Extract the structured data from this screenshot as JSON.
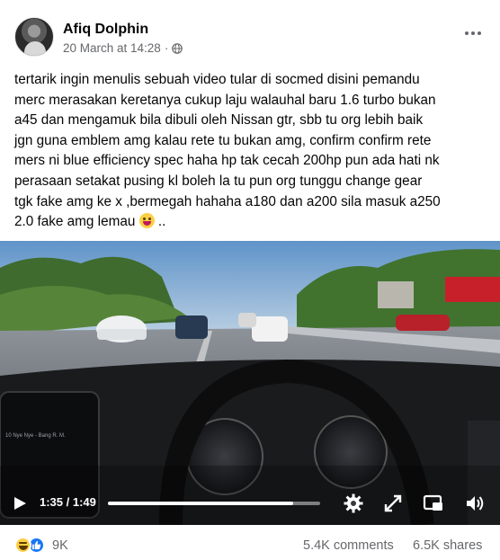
{
  "post": {
    "author": "Afiq Dolphin",
    "timestamp": "20 March at 14:28",
    "separator": "·",
    "privacy_icon": "globe-icon",
    "more_icon": "more-options-icon",
    "text": "tertarik ingin menulis sebuah video tular di socmed disini pemandu\nmerc merasakan keretanya cukup laju walauhal baru 1.6 turbo bukan\na45 dan mengamuk bila dibuli oleh Nissan gtr, sbb tu org lebih baik\njgn guna emblem amg kalau rete tu bukan amg, confirm confirm rete\nmers ni blue efficiency spec haha hp tak cecah 200hp pun ada hati nk\nperasaan  setakat pusing kl boleh la tu pun org tunggu change gear\ntgk fake amg ke x ,bermegah  hahaha a180 dan a200 sila masuk a250\n2.0 fake amg lemau",
    "text_end": " .."
  },
  "video": {
    "elapsed": "1:35",
    "duration": "1:49",
    "time_display": "1:35 / 1:49",
    "progress_fraction": 0.872,
    "icons": [
      "play-icon",
      "settings-icon",
      "fullscreen-icon",
      "picture-in-picture-icon",
      "volume-icon"
    ],
    "screen_text": "10 Nye Nye - Bang R. M."
  },
  "stats": {
    "reaction_count": "9K",
    "reactions": [
      "haha",
      "like"
    ],
    "comments": "5.4K comments",
    "shares": "6.5K shares"
  },
  "colors": {
    "text": "#050505",
    "secondary": "#65676b",
    "like_blue": "#1877f2",
    "haha_yellow": "#fbd043"
  }
}
